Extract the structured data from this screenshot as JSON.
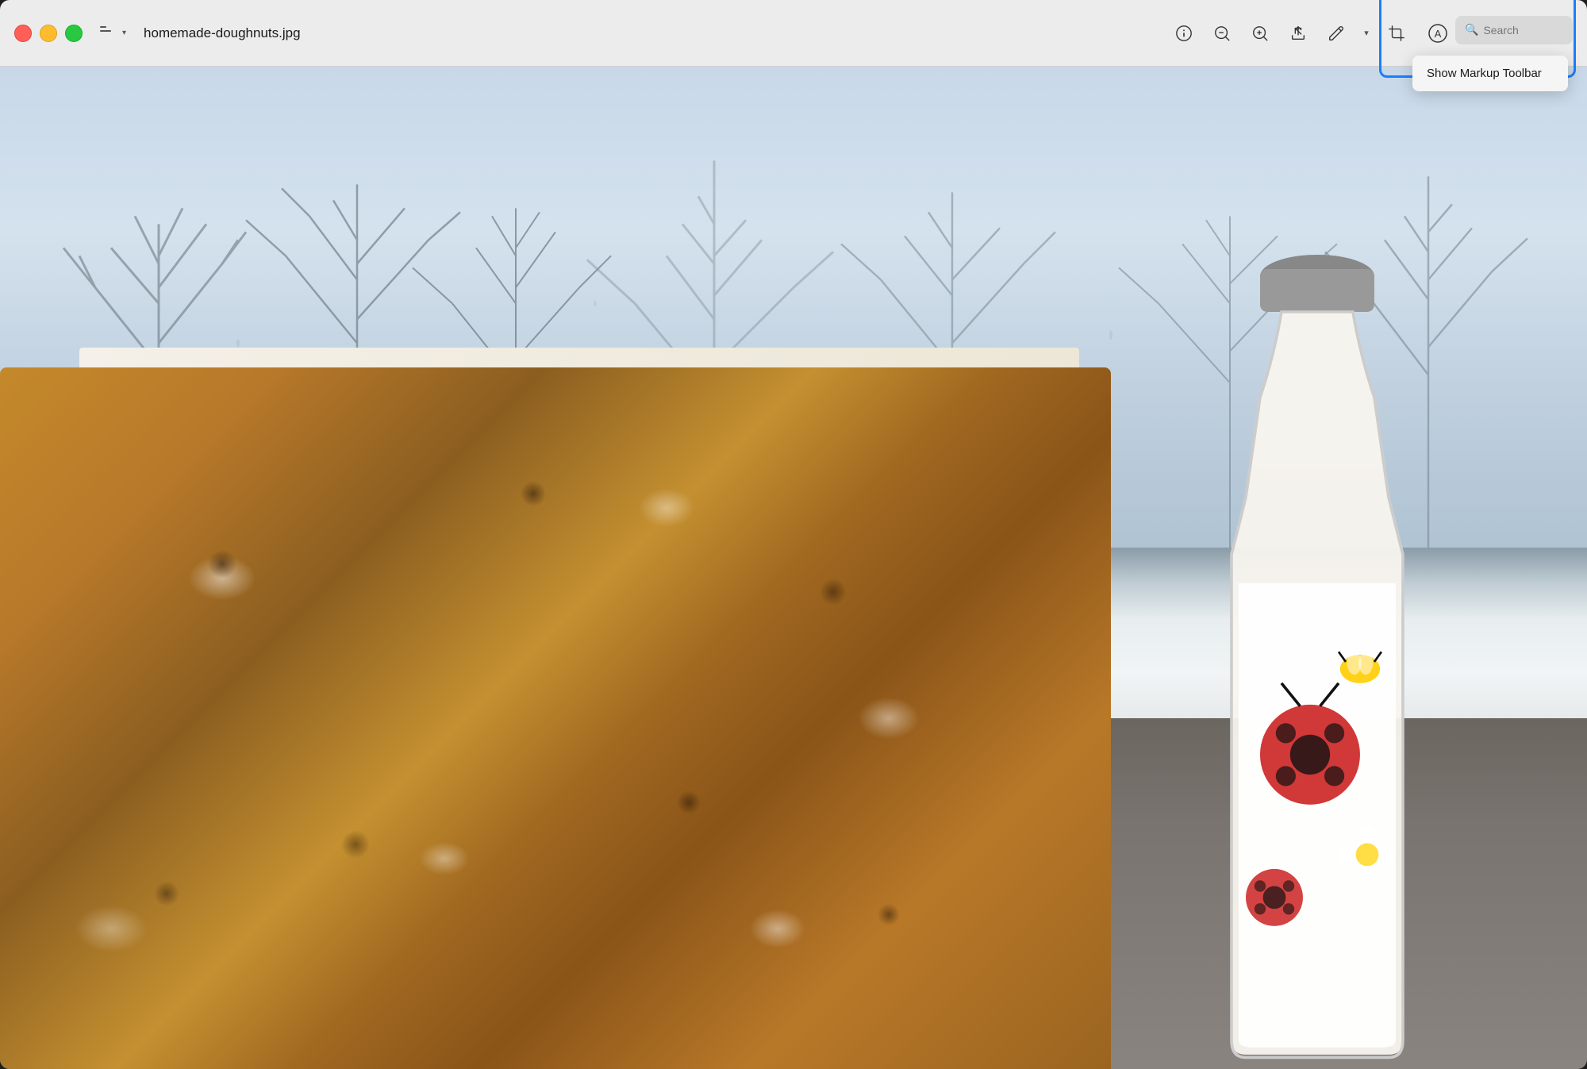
{
  "window": {
    "title": "homemade-doughnuts.jpg"
  },
  "traffic_lights": {
    "red_label": "close",
    "yellow_label": "minimize",
    "green_label": "maximize"
  },
  "sidebar_toggle": {
    "label": "sidebar-toggle",
    "chevron": "▾"
  },
  "toolbar": {
    "info_label": "info",
    "zoom_out_label": "zoom-out",
    "zoom_in_label": "zoom-in",
    "share_label": "share",
    "annotate_label": "annotate",
    "annotate_chevron": "▾",
    "crop_label": "crop",
    "markup_label": "markup"
  },
  "search": {
    "placeholder": "Search",
    "value": ""
  },
  "dropdown": {
    "items": [
      {
        "label": "Show Markup Toolbar"
      }
    ]
  },
  "highlight_box": {
    "color": "#1a7eff"
  }
}
